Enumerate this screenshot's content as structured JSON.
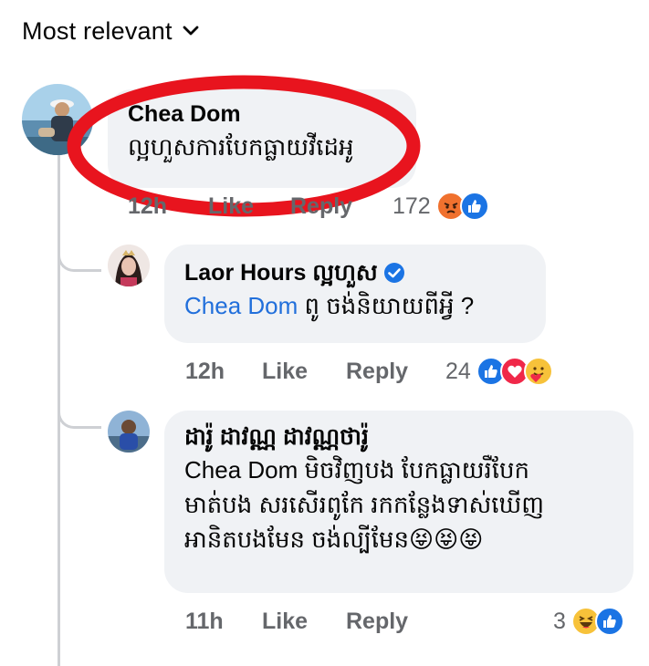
{
  "header": {
    "sort_label": "Most relevant"
  },
  "comments": [
    {
      "author": "Chea Dom",
      "text": "ល្អហួសការបែកធ្លាយវីដេអូ",
      "time": "12h",
      "like_label": "Like",
      "reply_label": "Reply",
      "reaction_count": "172",
      "reactions": [
        "angry-icon",
        "like-icon"
      ],
      "highlight_color": "#e8141e"
    },
    {
      "author": "Laor Hours ល្អហួស",
      "verified": true,
      "mention": "Chea Dom",
      "text": " ពូ ចង់និយាយពីអ្វី ?",
      "time": "12h",
      "like_label": "Like",
      "reply_label": "Reply",
      "reaction_count": "24",
      "reactions": [
        "like-icon",
        "love-icon",
        "care-icon"
      ]
    },
    {
      "author": "ដារ៉ូ ដាវណ្ណ ដាវណ្ណថារ៉ូ",
      "mention": "Chea Dom",
      "text_line1": " មិចវិញបង បែកធ្លាយរឺបែក",
      "text_line2": "មាត់បង សរសើរពូកែ រកកន្លែងទាស់ឃើញ",
      "text_line3": "អានិតបងមែន ចង់ល្បីមែន😝😝😝",
      "time": "11h",
      "like_label": "Like",
      "reply_label": "Reply",
      "reaction_count": "3",
      "reactions": [
        "haha-icon",
        "like-icon"
      ]
    }
  ],
  "colors": {
    "link": "#216fdb",
    "bubble": "#f0f2f5",
    "meta": "#65676b",
    "like_blue": "#1b74e4"
  }
}
